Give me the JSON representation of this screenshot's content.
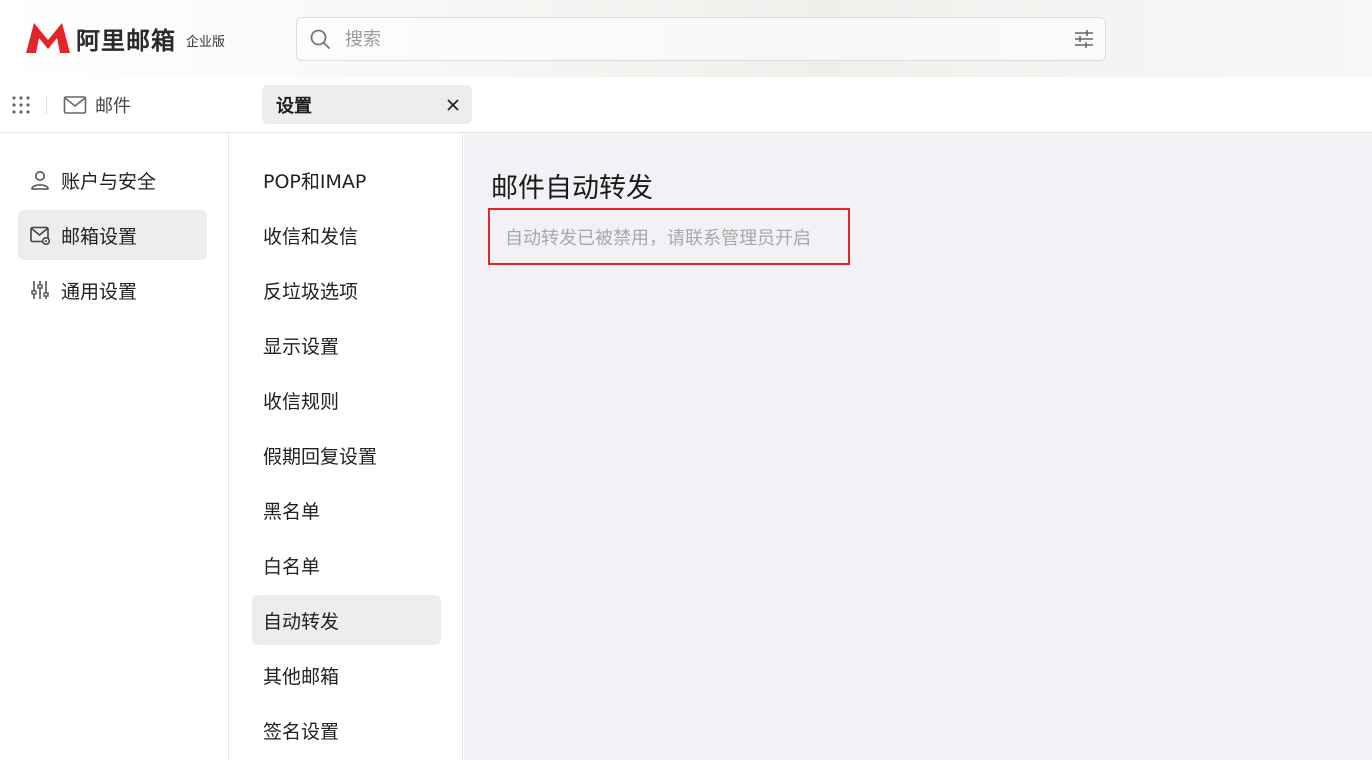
{
  "brand": {
    "name": "阿里邮箱",
    "edition": "企业版",
    "accent": "#e3242b"
  },
  "search": {
    "placeholder": "搜索",
    "value": ""
  },
  "nav": {
    "mail_label": "邮件",
    "tab": {
      "label": "设置"
    }
  },
  "sidebar": {
    "items": [
      {
        "label": "账户与安全",
        "icon": "user-icon",
        "active": false
      },
      {
        "label": "邮箱设置",
        "icon": "mailbox-settings-icon",
        "active": true
      },
      {
        "label": "通用设置",
        "icon": "sliders-icon",
        "active": false
      }
    ]
  },
  "submenu": {
    "items": [
      {
        "label": "POP和IMAP",
        "active": false
      },
      {
        "label": "收信和发信",
        "active": false
      },
      {
        "label": "反垃圾选项",
        "active": false
      },
      {
        "label": "显示设置",
        "active": false
      },
      {
        "label": "收信规则",
        "active": false
      },
      {
        "label": "假期回复设置",
        "active": false
      },
      {
        "label": "黑名单",
        "active": false
      },
      {
        "label": "白名单",
        "active": false
      },
      {
        "label": "自动转发",
        "active": true
      },
      {
        "label": "其他邮箱",
        "active": false
      },
      {
        "label": "签名设置",
        "active": false
      }
    ]
  },
  "content": {
    "title": "邮件自动转发",
    "notice": "自动转发已被禁用，请联系管理员开启"
  }
}
